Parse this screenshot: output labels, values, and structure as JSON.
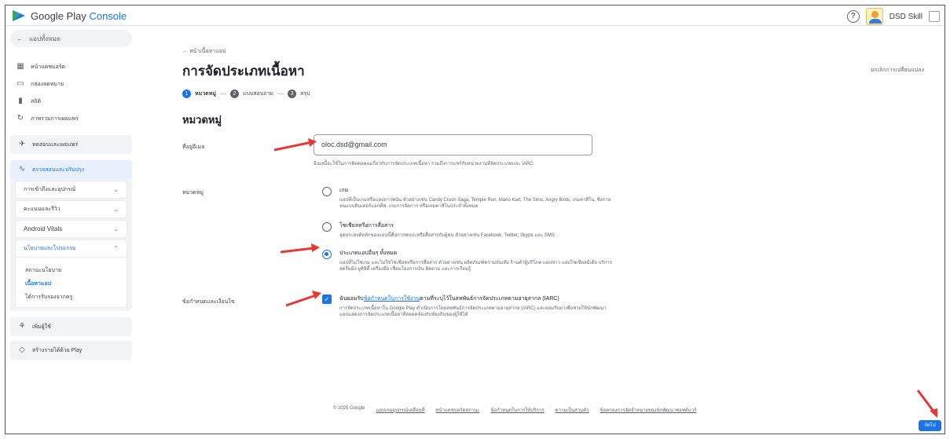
{
  "header": {
    "app_name_google": "Google Play",
    "app_name_console": "Console",
    "account_name": "DSD Skill"
  },
  "sidebar": {
    "back_label": "แอปทั้งหมด",
    "top_items": [
      {
        "label": "หน้าแดชบอร์ด",
        "icon": "dashboard-icon"
      },
      {
        "label": "กล่องจดหมาย",
        "icon": "inbox-icon"
      },
      {
        "label": "สถิติ",
        "icon": "stats-icon"
      },
      {
        "label": "ภาพรวมการเผยแพร่",
        "icon": "publishing-icon"
      }
    ],
    "test_release": "ทดสอบและเผยแพร่",
    "monitor_improve": "ตรวจสอบและปรับปรุง",
    "sections": [
      {
        "label": "การเข้าถึงและอุปกรณ์"
      },
      {
        "label": "คะแนนและรีวิว"
      },
      {
        "label": "Android Vitals"
      },
      {
        "label": "นโยบายและโปรแกรม"
      }
    ],
    "policy_links": [
      "สถานะนโยบาย",
      "เนื้อหาแอป",
      "ได้การรับรองจากครู"
    ],
    "grow_users": "เพิ่มผู้ใช้",
    "monetize": "สร้างรายได้ด้วย Play"
  },
  "main": {
    "breadcrumb": "← หน้าเนื้อหาแอป",
    "title": "การจัดประเภทเนื้อหา",
    "discard": "ยกเลิกการเปลี่ยนแปลง",
    "steps": [
      {
        "num": "1",
        "label": "หมวดหมู่"
      },
      {
        "num": "2",
        "label": "แบบสอบถาม"
      },
      {
        "num": "3",
        "label": "สรุป"
      }
    ],
    "section_title": "หมวดหมู่",
    "email_label": "ที่อยู่อีเมล",
    "email_value": "oloc.dsd@gmail.com",
    "email_help": "อีเมลนี้จะใช้ในการติดต่อคุณเกี่ยวกับการจัดประเภทเนื้อหา รวมถึงการแชร์กับหน่วยงานที่จัดประเภทและ IARC",
    "category_label": "หมวดหมู่",
    "options": [
      {
        "title": "เกม",
        "desc": "แอปที่เป็นเกมหรือแอปการพนัน ตัวอย่างเช่น Candy Crush Saga, Temple Run, Mario Kart, The Sims, Angry Birds, เกมคาสิโน, ซิงกาลหนแบบอินเทอร์แอกทีฟ, เกมการจัดการ หรือเกมคาสิโนประจำทั้งหมด",
        "selected": false
      },
      {
        "title": "โซเชียลหรือการสื่อสาร",
        "desc": "จุดประสงค์หลักของแอปนี้คือการพบปะหรือสื่อสารกับผู้คน ตัวอย่างเช่น Facebook, Twitter, Skype และ SMS",
        "selected": false
      },
      {
        "title": "ประเภทแอปอื่นๆ ทั้งหมด",
        "desc": "แอปที่ไม่ใช่เกม และไม่ใช่โซเชียลหรือการสื่อสาร ตัวอย่างเช่น ผลิตภัณฑ์ความบันเทิง ร้านค้าผู้บริโภค แอปข่าว แอปโซเชียลมีเดีย บริการสตรีมมิ่ง ยูทิลิตี้ เครื่องมือ เชื่อมโยงการเงิน ติดตาม และการเรียนรู้",
        "selected": true
      }
    ],
    "terms_label": "ข้อกำหนดและเงื่อนไข",
    "terms_pre": "ฉันยอมรับ",
    "terms_link": "ข้อกำหนดในการใช้งาน",
    "terms_post": "ตามที่ระบุไว้ในสหพันธ์การจัดประเภทตามอายุสากล (IARC)",
    "terms_desc": "การจัดประเภทเนื้อหาใน Google Play ดำเนินการโดยสหพันธ์การจัดประเภทตามอายุสากล (IARC) และยอมรับมาเพื่อช่วยให้นักพัฒนาแอปแสดงการจัดประเภทเนื้อหาที่สอดคล้องกับท้องถิ่นของผู้ใช้ได้",
    "terms_checked": true
  },
  "footer": {
    "copyright": "© 2025 Google",
    "links": [
      "แอปเกมอุปกรณ์เคลื่อนที่",
      "หน้าแดชบอร์ดสถานะ",
      "ข้อกำหนดในการให้บริการ",
      "ความเป็นส่วนตัว",
      "ข้อตกลงการจัดจำหน่ายของนักพัฒนาซอฟต์แวร์"
    ]
  },
  "next_button": "ถัดไป",
  "colors": {
    "accent": "#1a73e8",
    "arrow": "#e53935"
  }
}
